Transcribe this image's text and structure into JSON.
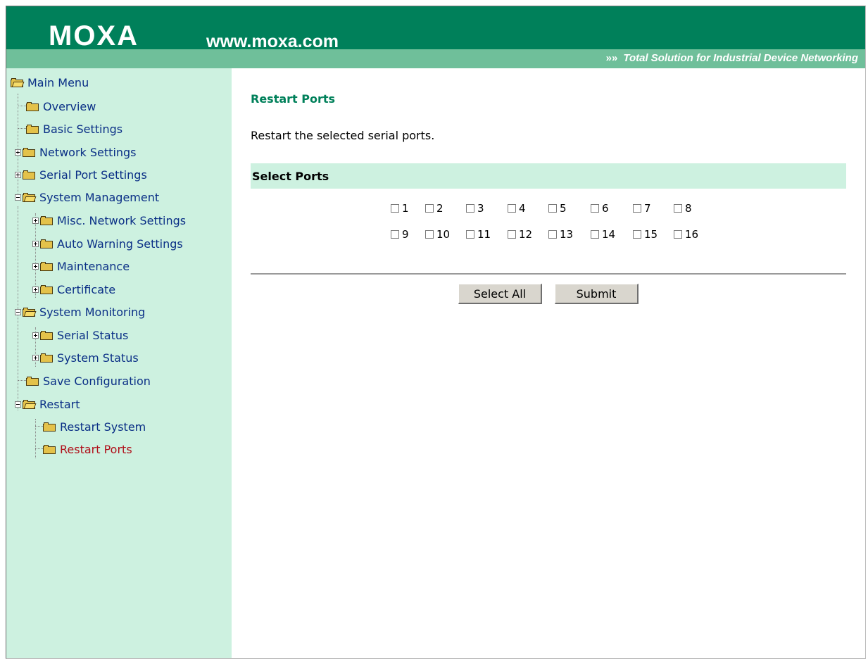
{
  "header": {
    "logo": "MOXA",
    "url": "www.moxa.com",
    "tagline_arrows": "»»",
    "tagline": "Total Solution for Industrial Device Networking"
  },
  "sidebar": {
    "items": [
      {
        "label": "Main Menu",
        "icon": "folder-open-icon"
      },
      {
        "label": "Overview",
        "icon": "folder-icon"
      },
      {
        "label": "Basic Settings",
        "icon": "folder-icon"
      },
      {
        "label": "Network Settings",
        "icon": "folder-icon"
      },
      {
        "label": "Serial Port Settings",
        "icon": "folder-icon"
      },
      {
        "label": "System Management",
        "icon": "folder-open-icon"
      },
      {
        "label": "Misc. Network Settings",
        "icon": "folder-icon"
      },
      {
        "label": "Auto Warning Settings",
        "icon": "folder-icon"
      },
      {
        "label": "Maintenance",
        "icon": "folder-icon"
      },
      {
        "label": "Certificate",
        "icon": "folder-icon"
      },
      {
        "label": "System Monitoring",
        "icon": "folder-open-icon"
      },
      {
        "label": "Serial Status",
        "icon": "folder-icon"
      },
      {
        "label": "System Status",
        "icon": "folder-icon"
      },
      {
        "label": "Save Configuration",
        "icon": "folder-icon"
      },
      {
        "label": "Restart",
        "icon": "folder-open-icon"
      },
      {
        "label": "Restart System",
        "icon": "folder-icon"
      },
      {
        "label": "Restart Ports",
        "icon": "folder-icon",
        "active": true
      }
    ]
  },
  "main": {
    "title": "Restart Ports",
    "description": "Restart the selected serial ports.",
    "section_title": "Select Ports",
    "ports_row1": [
      "1",
      "2",
      "3",
      "4",
      "5",
      "6",
      "7",
      "8"
    ],
    "ports_row2": [
      "9",
      "10",
      "11",
      "12",
      "13",
      "14",
      "15",
      "16"
    ],
    "select_all_label": "Select All",
    "submit_label": "Submit"
  },
  "colors": {
    "header_green": "#00805a",
    "strip_green": "#6fbf9a",
    "sidebar_bg": "#cdf1e0",
    "link_blue": "#0a2f86",
    "active_red": "#b0101a"
  }
}
